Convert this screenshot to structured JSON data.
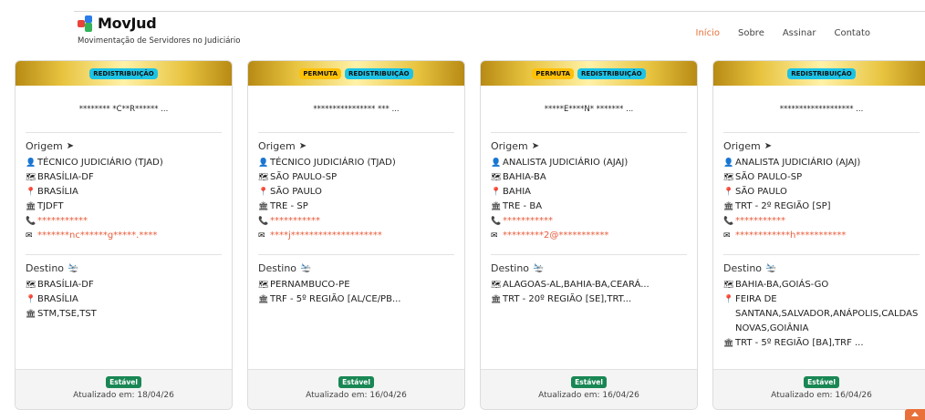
{
  "brand": {
    "name": "MovJud",
    "subtitle": "Movimentação de Servidores no Judiciário"
  },
  "nav": {
    "items": [
      "Início",
      "Sobre",
      "Assinar",
      "Contato"
    ],
    "active": "Início"
  },
  "labels": {
    "origem": "Origem",
    "destino": "Destino",
    "updated_prefix": "Atualizado em:"
  },
  "colors": {
    "accent": "#e8703a",
    "tag_redistribuicao": "#1cc3e6",
    "tag_permuta": "#ffc107",
    "badge_estavel": "#198754"
  },
  "cards": [
    {
      "tags": [
        "REDISTRIBUIÇÃO"
      ],
      "name": "******** *C**R****** ...",
      "origem": {
        "cargo": "TÉCNICO JUDICIÁRIO (TJAD)",
        "uf": "BRASÍLIA-DF",
        "cidade": "BRASÍLIA",
        "orgao": "TJDFT",
        "telefone": "***********",
        "email": "*******nc******g*****.****"
      },
      "destino": {
        "uf": "BRASÍLIA-DF",
        "cidade": "BRASÍLIA",
        "orgao": "STM,TSE,TST"
      },
      "status": "Estável",
      "updated_label": "Atualizado em: 18/04/26"
    },
    {
      "tags": [
        "PERMUTA",
        "REDISTRIBUIÇÃO"
      ],
      "name": "**************** *** ...",
      "origem": {
        "cargo": "TÉCNICO JUDICIÁRIO (TJAD)",
        "uf": "SÃO PAULO-SP",
        "cidade": "SÃO PAULO",
        "orgao": "TRE - SP",
        "telefone": "***********",
        "email": "****j********************"
      },
      "destino": {
        "uf": "PERNAMBUCO-PE",
        "orgao": "TRF - 5º REGIÃO [AL/CE/PB..."
      },
      "status": "Estável",
      "updated_label": "Atualizado em: 16/04/26"
    },
    {
      "tags": [
        "PERMUTA",
        "REDISTRIBUIÇÃO"
      ],
      "name": "*****E****N* ******* ...",
      "origem": {
        "cargo": "ANALISTA JUDICIÁRIO (AJAJ)",
        "uf": "BAHIA-BA",
        "cidade": "BAHIA",
        "orgao": "TRE - BA",
        "telefone": "***********",
        "email": "*********2@***********"
      },
      "destino": {
        "uf": "ALAGOAS-AL,BAHIA-BA,CEARÁ...",
        "orgao": "TRT - 20º REGIÃO [SE],TRT..."
      },
      "status": "Estável",
      "updated_label": "Atualizado em: 16/04/26"
    },
    {
      "tags": [
        "REDISTRIBUIÇÃO"
      ],
      "name": "******************* ...",
      "origem": {
        "cargo": "ANALISTA JUDICIÁRIO (AJAJ)",
        "uf": "SÃO PAULO-SP",
        "cidade": "SÃO PAULO",
        "orgao": "TRT - 2º REGIÃO [SP]",
        "telefone": "***********",
        "email": "************h***********"
      },
      "destino": {
        "uf": "BAHIA-BA,GOIÁS-GO",
        "cidade": "FEIRA DE SANTANA,SALVADOR,ANÁPOLIS,CALDAS NOVAS,GOIÂNIA",
        "orgao": "TRT - 5º REGIÃO [BA],TRF ..."
      },
      "status": "Estável",
      "updated_label": "Atualizado em: 16/04/26"
    }
  ]
}
